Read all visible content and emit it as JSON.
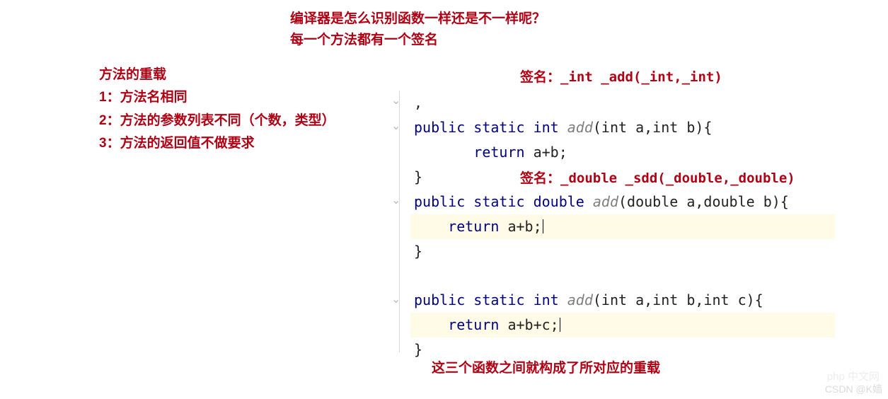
{
  "header": {
    "line1": "编译器是怎么识别函数一样还是不一样呢？",
    "line2": "每一个方法都有一个签名"
  },
  "rules": {
    "title": "方法的重载",
    "r1": "1：方法名相同",
    "r2": "2：方法的参数列表不同（个数，类型）",
    "r3": "3：方法的返回值不做要求"
  },
  "signature1": "签名：_int   _add(_int,_int)",
  "signature2": "签名：_double _sdd(_double,_double)",
  "code": {
    "l0": ",",
    "kw_public": "public",
    "kw_static": "static",
    "t_int": "int",
    "t_double": "double",
    "fn_add": "add",
    "params1": "(int a,int b){",
    "params2": "(double a,double b){",
    "params3": "(int a,int b,int c){",
    "kw_return": "return",
    "ret1": " a+b;",
    "ret2": " a+b;",
    "ret3": " a+b+c;",
    "brace_close": "}"
  },
  "bottom_note": "这三个函数之间就构成了所对应的重载",
  "watermark_php": "php 中文网",
  "watermark_csdn": "CSDN @K嫱"
}
